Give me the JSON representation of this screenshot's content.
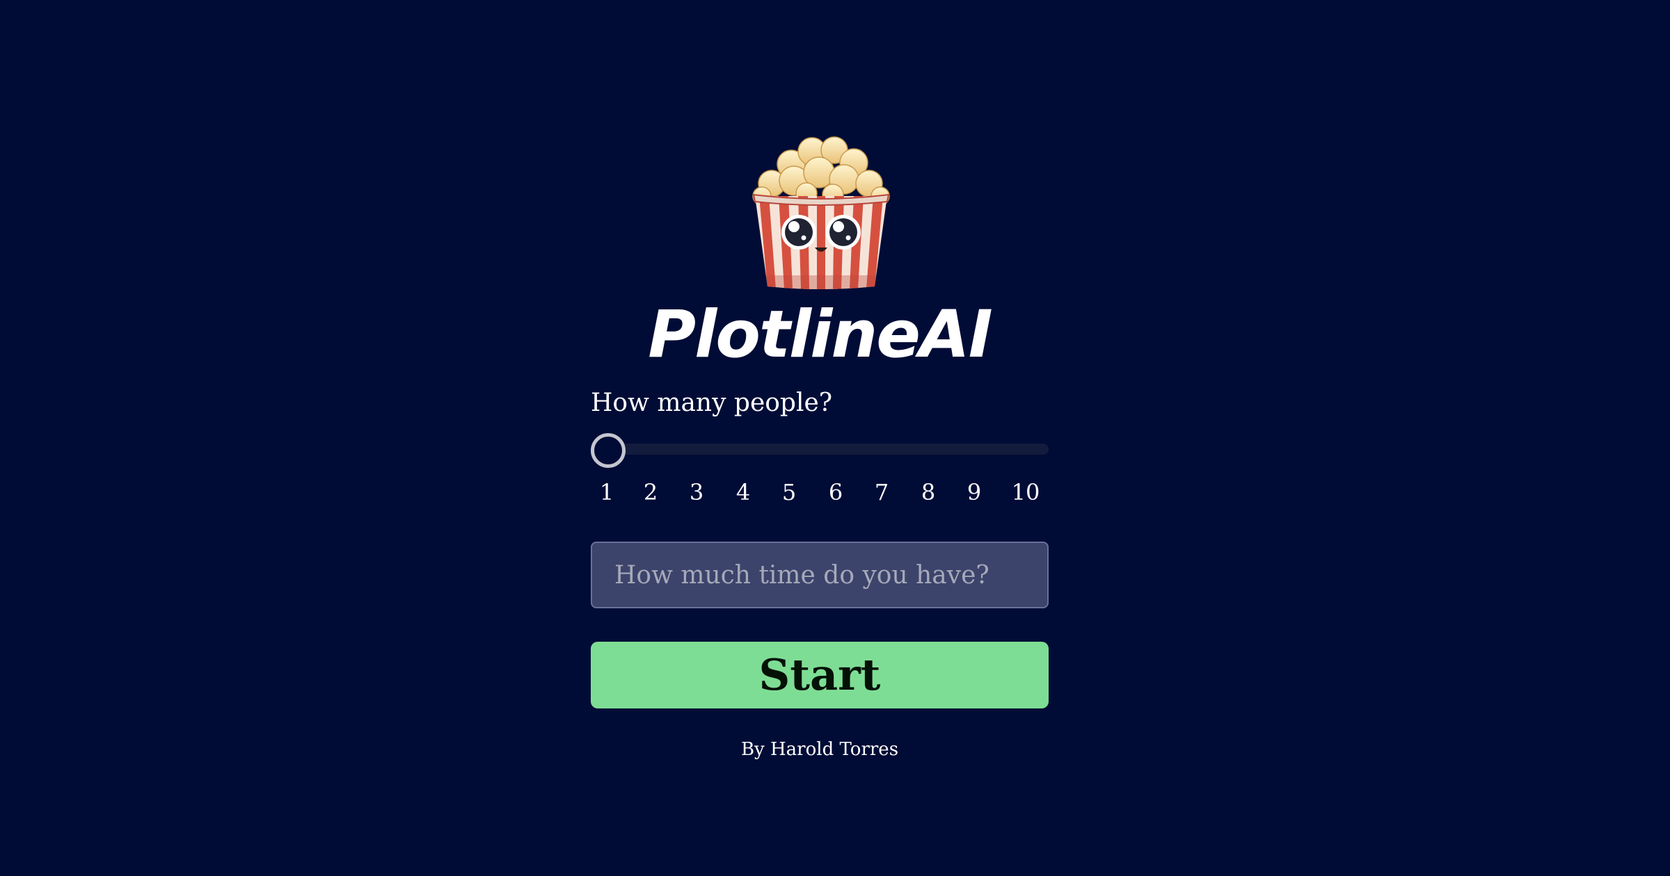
{
  "app": {
    "title": "PlotlineAI",
    "logo_icon": "popcorn-mascot-icon"
  },
  "people": {
    "label": "How many people?",
    "min": 1,
    "max": 10,
    "value": 1,
    "ticks": [
      "1",
      "2",
      "3",
      "4",
      "5",
      "6",
      "7",
      "8",
      "9",
      "10"
    ]
  },
  "time": {
    "placeholder": "How much time do you have?",
    "value": ""
  },
  "start_button": {
    "label": "Start"
  },
  "footer": {
    "byline": "By Harold Torres"
  },
  "colors": {
    "background": "#000c36",
    "accent": "#7edd94",
    "input_bg": "#3c446c",
    "track": "#141c3d"
  }
}
